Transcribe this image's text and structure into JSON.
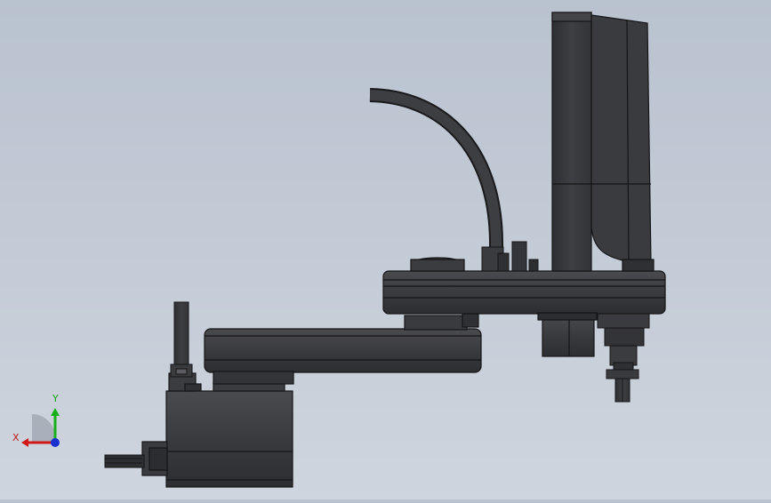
{
  "viewport": {
    "background_top": "#b9c2cf",
    "background_bottom": "#cfd5de",
    "model_body_color": "#3b3c3f",
    "model_edge_color": "#1a1a1c"
  },
  "model": {
    "name": "",
    "components": [
      "base-unit",
      "base-cable",
      "first-arm",
      "upper-arm",
      "cable-conduit",
      "controller-box",
      "z-axis-shaft",
      "ball-spline",
      "motor-housing"
    ]
  },
  "triad": {
    "x_label": "X",
    "y_label": "Y",
    "z_label": "",
    "x_color": "#d01818",
    "y_color": "#18b018",
    "z_color": "#1830d0"
  }
}
